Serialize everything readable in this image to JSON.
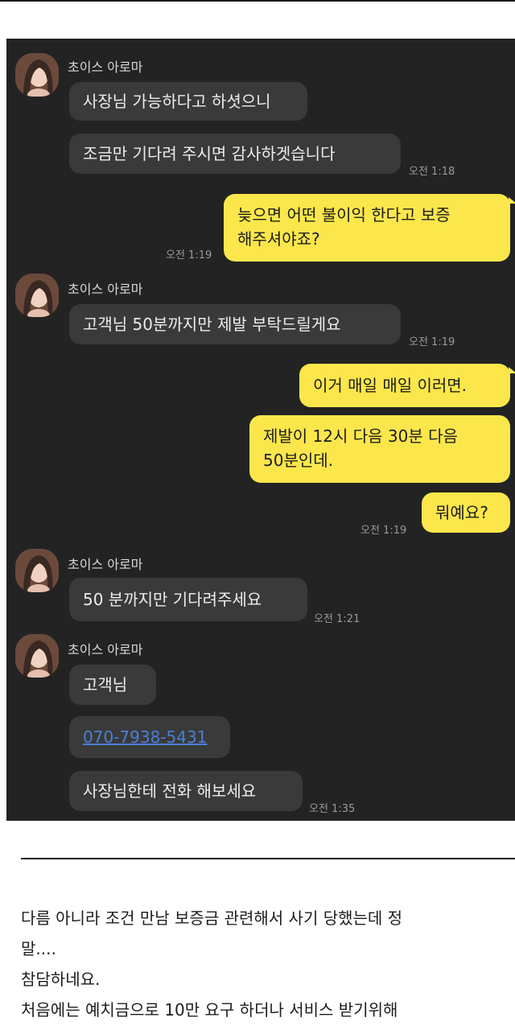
{
  "chat": {
    "sender_name": "초이스 아로마",
    "messages": {
      "m1": "사장님 가능하다고 하셧으니",
      "m2": "조금만 기다려 주시면  감사하겟습니다",
      "m2_time": "오전 1:18",
      "m3_line1": "늦으면 어떤 불이익 한다고 보증",
      "m3_line2": "해주셔야죠?",
      "m3_time": "오전 1:19",
      "m4": "고객님 50분까지만 제발 부탁드릴게요",
      "m4_time": "오전 1:19",
      "m5": "이거 매일 매일 이러면.",
      "m6_line1": "제발이 12시 다음 30분 다음",
      "m6_line2": "50분인데.",
      "m7": "뭐예요?",
      "m7_time": "오전 1:19",
      "m8": "50 분까지만 기다려주세요",
      "m8_time": "오전 1:21",
      "m9": "고객님",
      "m10": "070-7938-5431",
      "m11": "사장님한테 전화 해보세요",
      "m11_time": "오전 1:35"
    }
  },
  "post": {
    "line1": "다름 아니라 조건 만남 보증금 관련해서 사기 당했는데 정",
    "line2": "말....",
    "line3": "참담하네요.",
    "line4": "처음에는 예치금으로 10만 요구 하더나 서비스 받기위해"
  },
  "colors": {
    "chat_background": "#232323",
    "incoming_bubble": "#3a3a3a",
    "outgoing_bubble": "#fbe74b",
    "link": "#4a7fd6"
  }
}
